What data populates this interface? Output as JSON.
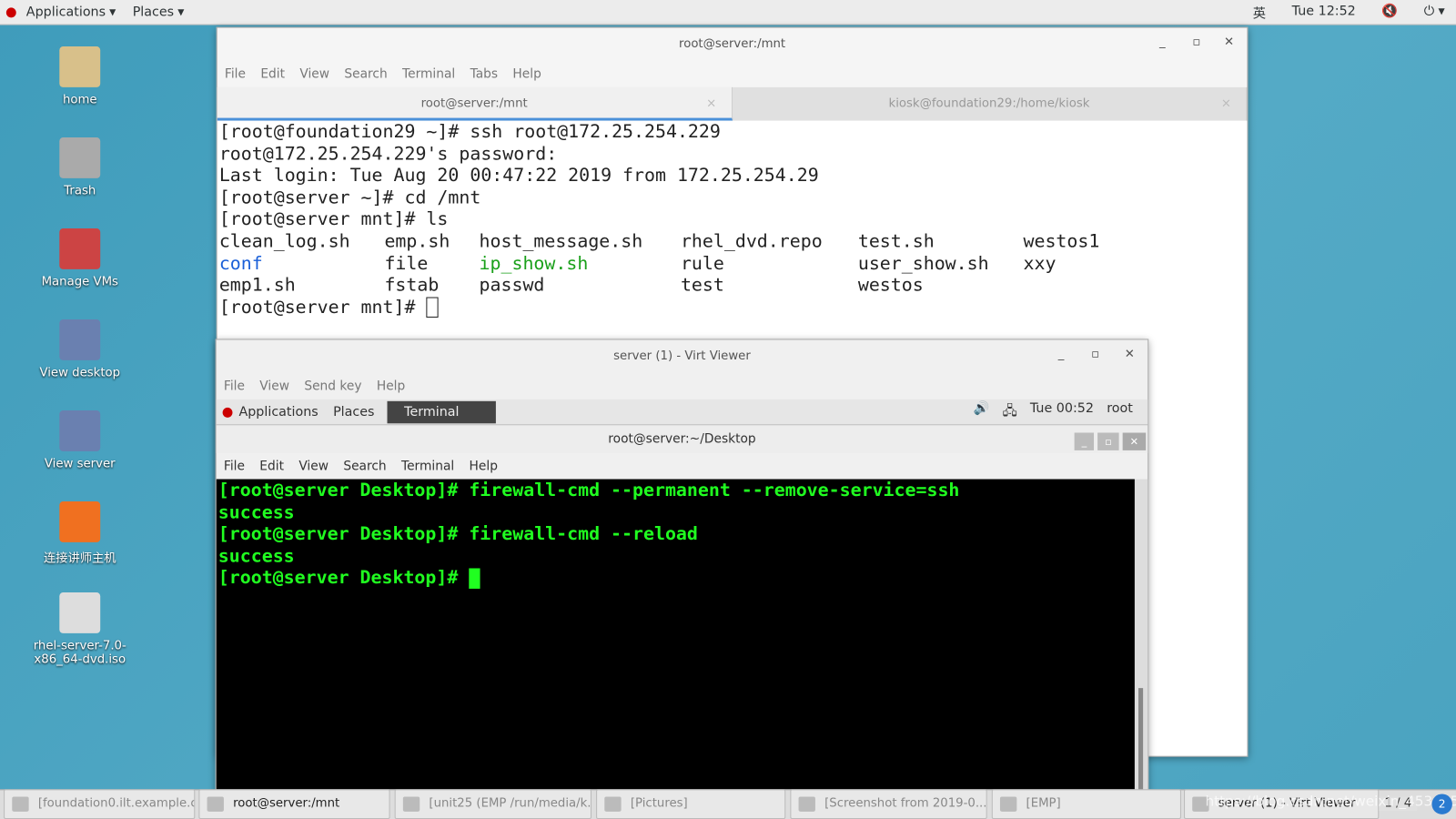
{
  "topbar": {
    "applications": "Applications",
    "places": "Places",
    "ime": "英",
    "clock": "Tue 12:52"
  },
  "desktop": [
    {
      "label": "home",
      "icon": "home-folder-icon"
    },
    {
      "label": "Trash",
      "icon": "trash-icon"
    },
    {
      "label": "Manage VMs",
      "icon": "vm-icon"
    },
    {
      "label": "View desktop",
      "icon": "monitor-icon"
    },
    {
      "label": "View server",
      "icon": "monitor-icon"
    },
    {
      "label": "连接讲师主机",
      "icon": "remote-icon"
    },
    {
      "label": "rhel-server-7.0-x86_64-dvd.iso",
      "icon": "disc-icon"
    }
  ],
  "terminal1": {
    "title": "root@server:/mnt",
    "menu": [
      "File",
      "Edit",
      "View",
      "Search",
      "Terminal",
      "Tabs",
      "Help"
    ],
    "tabs": [
      "root@server:/mnt",
      "kiosk@foundation29:/home/kiosk"
    ],
    "lines": [
      "[root@foundation29 ~]# ssh root@172.25.254.229",
      "root@172.25.254.229's password:",
      "Last login: Tue Aug 20 00:47:22 2019 from 172.25.254.29",
      "[root@server ~]# cd /mnt",
      "[root@server mnt]# ls"
    ],
    "ls": [
      [
        "clean_log.sh",
        "emp.sh",
        "host_message.sh",
        "rhel_dvd.repo",
        "test.sh",
        "westos1"
      ],
      [
        "conf",
        "file",
        "ip_show.sh",
        "rule",
        "user_show.sh",
        "xxy"
      ],
      [
        "emp1.sh",
        "fstab",
        "passwd",
        "test",
        "westos",
        ""
      ]
    ],
    "prompt": "[root@server mnt]# "
  },
  "virt": {
    "title": "server (1) - Virt Viewer",
    "menu": [
      "File",
      "View",
      "Send key",
      "Help"
    ],
    "guest_bar": {
      "applications": "Applications",
      "places": "Places",
      "terminal": "Terminal",
      "clock": "Tue 00:52",
      "user": "root"
    },
    "term_title": "root@server:~/Desktop",
    "term_menu": [
      "File",
      "Edit",
      "View",
      "Search",
      "Terminal",
      "Help"
    ],
    "lines": [
      "[root@server Desktop]# firewall-cmd --permanent --remove-service=ssh",
      "success",
      "[root@server Desktop]# firewall-cmd --reload",
      "success",
      "[root@server Desktop]# "
    ]
  },
  "taskbar": [
    "[foundation0.ilt.example.c...",
    "root@server:/mnt",
    "[unit25 (EMP /run/media/k...",
    "[Pictures]",
    "[Screenshot from 2019-0...",
    "[EMP]",
    "server (1) - Virt Viewer"
  ],
  "workspace": "1 / 4",
  "watermark": "https://blog.csdn.net/weixin_45368529"
}
